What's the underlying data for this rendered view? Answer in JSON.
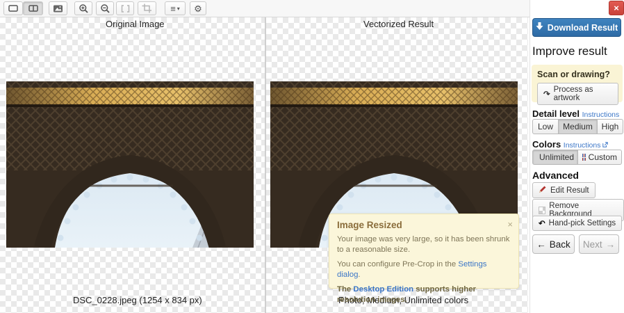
{
  "window": {
    "close_icon": "×"
  },
  "toolbar": {
    "buttons": [
      "single-view",
      "split-view",
      "image-view",
      "zoom-in",
      "zoom-out",
      "zoom-fit",
      "crop",
      "view-options",
      "settings"
    ],
    "view_options_glyph": "≡",
    "caret_glyph": "▾",
    "settings_glyph": "⚙"
  },
  "panels": {
    "original": {
      "title": "Original Image",
      "footer": "DSC_0228.jpeg (1254 x 834 px)"
    },
    "vectorized": {
      "title": "Vectorized Result",
      "footer": "Photo, Medium, Unlimited colors"
    }
  },
  "notification": {
    "title": "Image Resized",
    "close_icon": "×",
    "line1": "Your image was very large, so it has been shrunk to a reasonable size.",
    "line2_prefix": "You can configure Pre-Crop in the ",
    "line2_link": "Settings dialog",
    "line2_suffix": ".",
    "line3_prefix": "The ",
    "line3_link": "Desktop Edition",
    "line3_suffix": " supports higher resolution images."
  },
  "sidebar": {
    "download_button": "Download Result",
    "improve_heading": "Improve result",
    "scan_question": "Scan or drawing?",
    "process_artwork_button": "Process as artwork",
    "process_artwork_icon": "↷",
    "detail_level_label": "Detail level",
    "instructions_link": "Instructions",
    "detail_options": {
      "low": "Low",
      "medium": "Medium",
      "high": "High"
    },
    "detail_selected": "Medium",
    "colors_label": "Colors",
    "color_options": {
      "unlimited": "Unlimited",
      "custom": "Custom"
    },
    "colors_selected": "Unlimited",
    "advanced_heading": "Advanced",
    "edit_result_button": "Edit Result",
    "remove_background_button": "Remove Background",
    "handpick_settings_button": "Hand-pick Settings",
    "handpick_icon": "↶",
    "back_button": "Back",
    "back_arrow": "←",
    "next_button": "Next",
    "next_arrow": "→"
  },
  "colors": {
    "accent_blue": "#33699f",
    "close_red": "#c9423a",
    "warning_bg": "#fbf6da",
    "warning_text": "#8a6d3b",
    "link_blue": "#3b76c7"
  }
}
